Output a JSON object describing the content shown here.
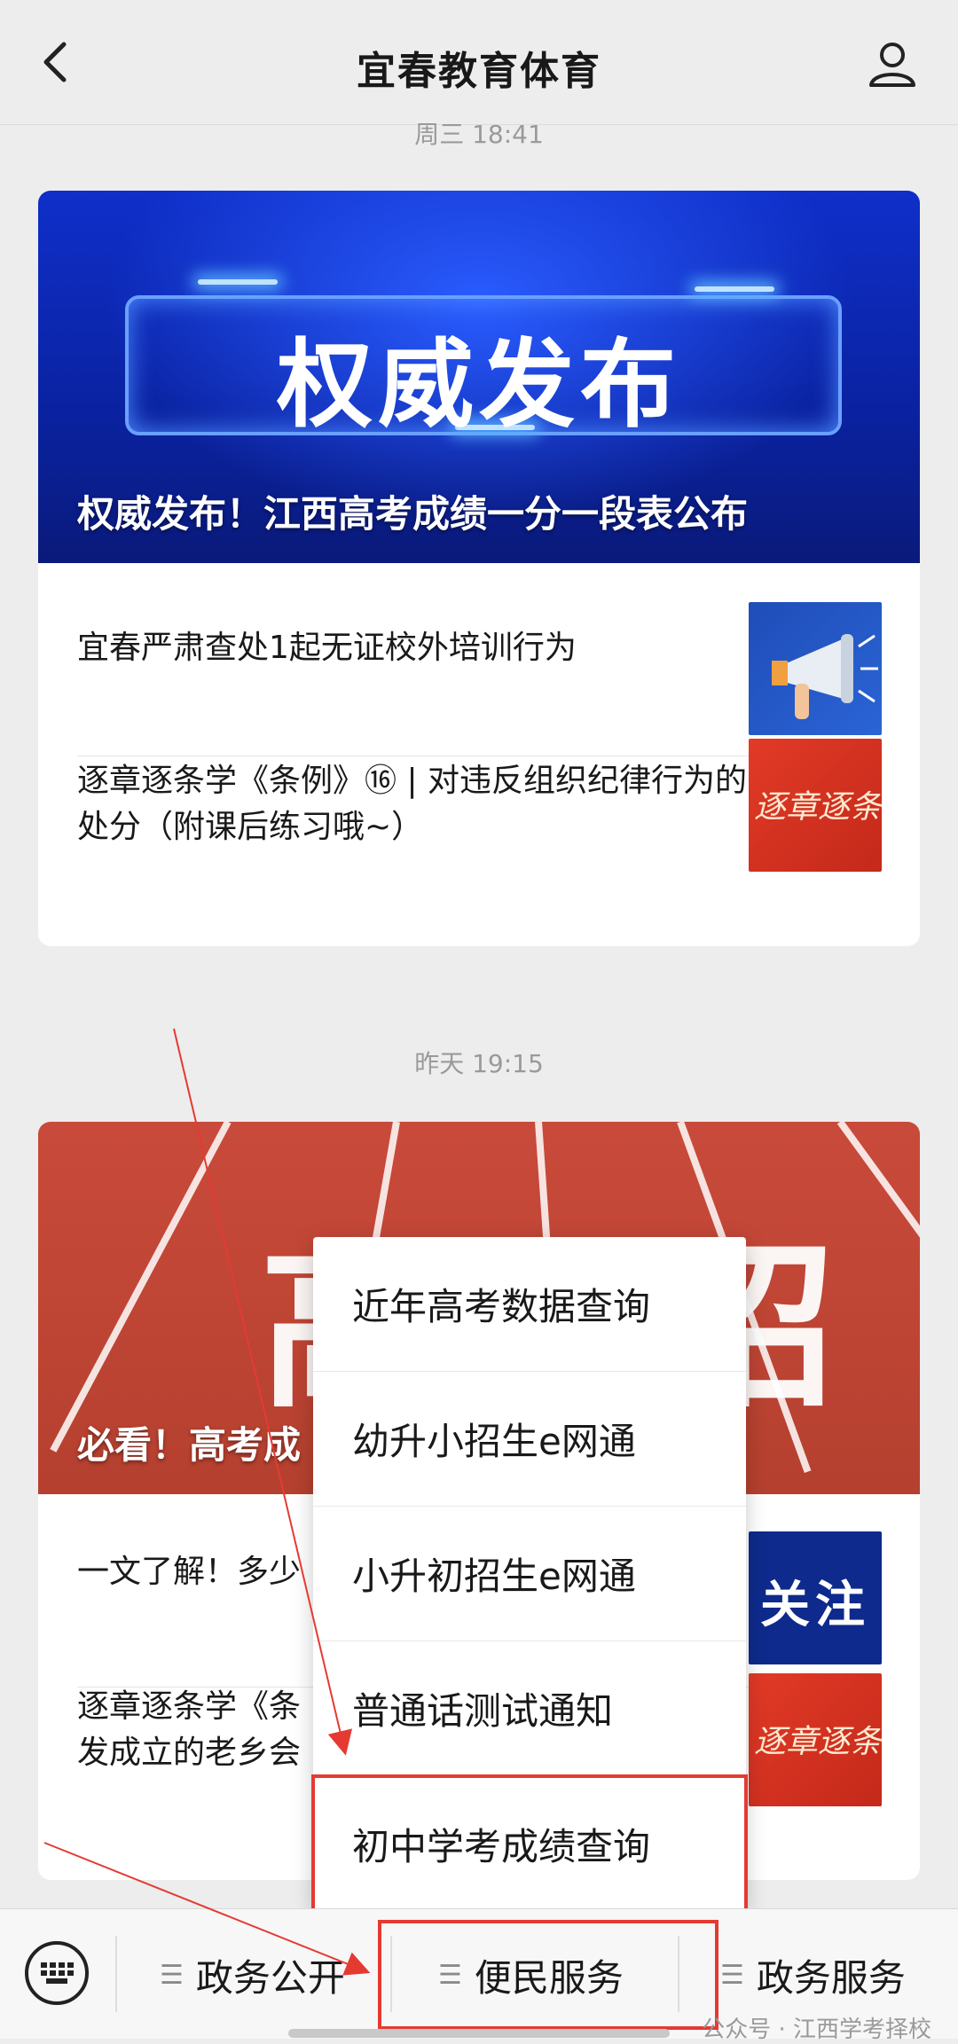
{
  "header": {
    "title": "宜春教育体育"
  },
  "feed": [
    {
      "timestamp": "周三 18:41",
      "hero": {
        "banner_text": "权威发布",
        "caption": "权威发布！江西高考成绩一分一段表公布"
      },
      "items": [
        {
          "title": "宜春严肃查处1起无证校外培训行为",
          "thumb": "megaphone"
        },
        {
          "title": "逐章逐条学《条例》⑯ | 对违反组织纪律行为的处分（附课后练习哦~）",
          "thumb": "red-calligraphy",
          "thumb_text": "逐章逐条"
        }
      ]
    },
    {
      "timestamp": "昨天 19:15",
      "hero": {
        "banner_text": "高 招",
        "caption": "必看！高考成"
      },
      "items": [
        {
          "title": "一文了解！多少",
          "thumb": "navy-follow",
          "thumb_text": "关注"
        },
        {
          "title": "逐章逐条学《条\n发成立的老乡会",
          "thumb": "red-calligraphy",
          "thumb_text": "逐章逐条"
        }
      ]
    }
  ],
  "menu": {
    "items": [
      "近年高考数据查询",
      "幼升小招生e网通",
      "小升初招生e网通",
      "普通话测试通知",
      "初中学考成绩查询"
    ],
    "highlighted_index": 4
  },
  "bottom_tabs": [
    {
      "label": "政务公开"
    },
    {
      "label": "便民服务",
      "highlighted": true
    },
    {
      "label": "政务服务"
    }
  ],
  "watermark": "公众号 · 江西学考择校",
  "colors": {
    "highlight": "#e53a32",
    "background": "#ededed"
  }
}
